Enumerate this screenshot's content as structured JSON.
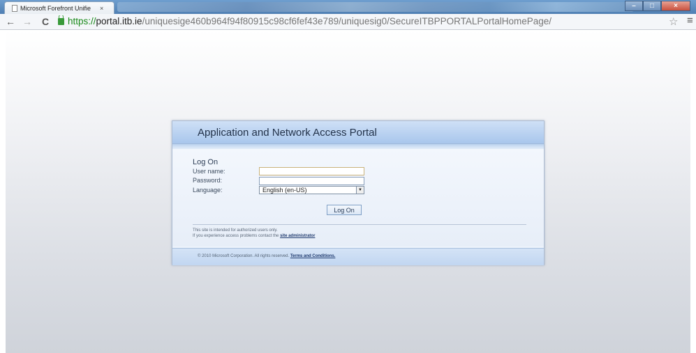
{
  "browser": {
    "tab_title": "Microsoft Forefront Unifie",
    "tab_close": "×",
    "url_scheme": "https://",
    "url_host": "portal.itb.ie",
    "url_path": "/uniquesige460b964f94f80915c98cf6fef43e789/uniquesig0/SecureITBPPORTALPortalHomePage/",
    "back": "←",
    "forward": "→",
    "reload": "C",
    "star": "☆",
    "menu": "≡",
    "minimize": "–",
    "maximize": "□",
    "close": "×"
  },
  "portal": {
    "title": "Application and Network Access Portal",
    "form": {
      "heading": "Log On",
      "username_label": "User name:",
      "password_label": "Password:",
      "language_label": "Language:",
      "username_value": "",
      "password_value": "",
      "language_selected": "English (en-US)",
      "submit_label": "Log On"
    },
    "notice": {
      "line1": "This site is intended for authorized users only.",
      "line2_prefix": "If you experience access problems contact the ",
      "line2_link": "site administrator"
    },
    "footer": {
      "copyright": "© 2010 Microsoft Corporation. All rights reserved. ",
      "terms_link": "Terms and Conditions."
    }
  },
  "colors": {
    "header_gradient_top": "#cfe0f6",
    "header_gradient_bottom": "#a8c6ec",
    "secure_green": "#1b8a1b"
  }
}
